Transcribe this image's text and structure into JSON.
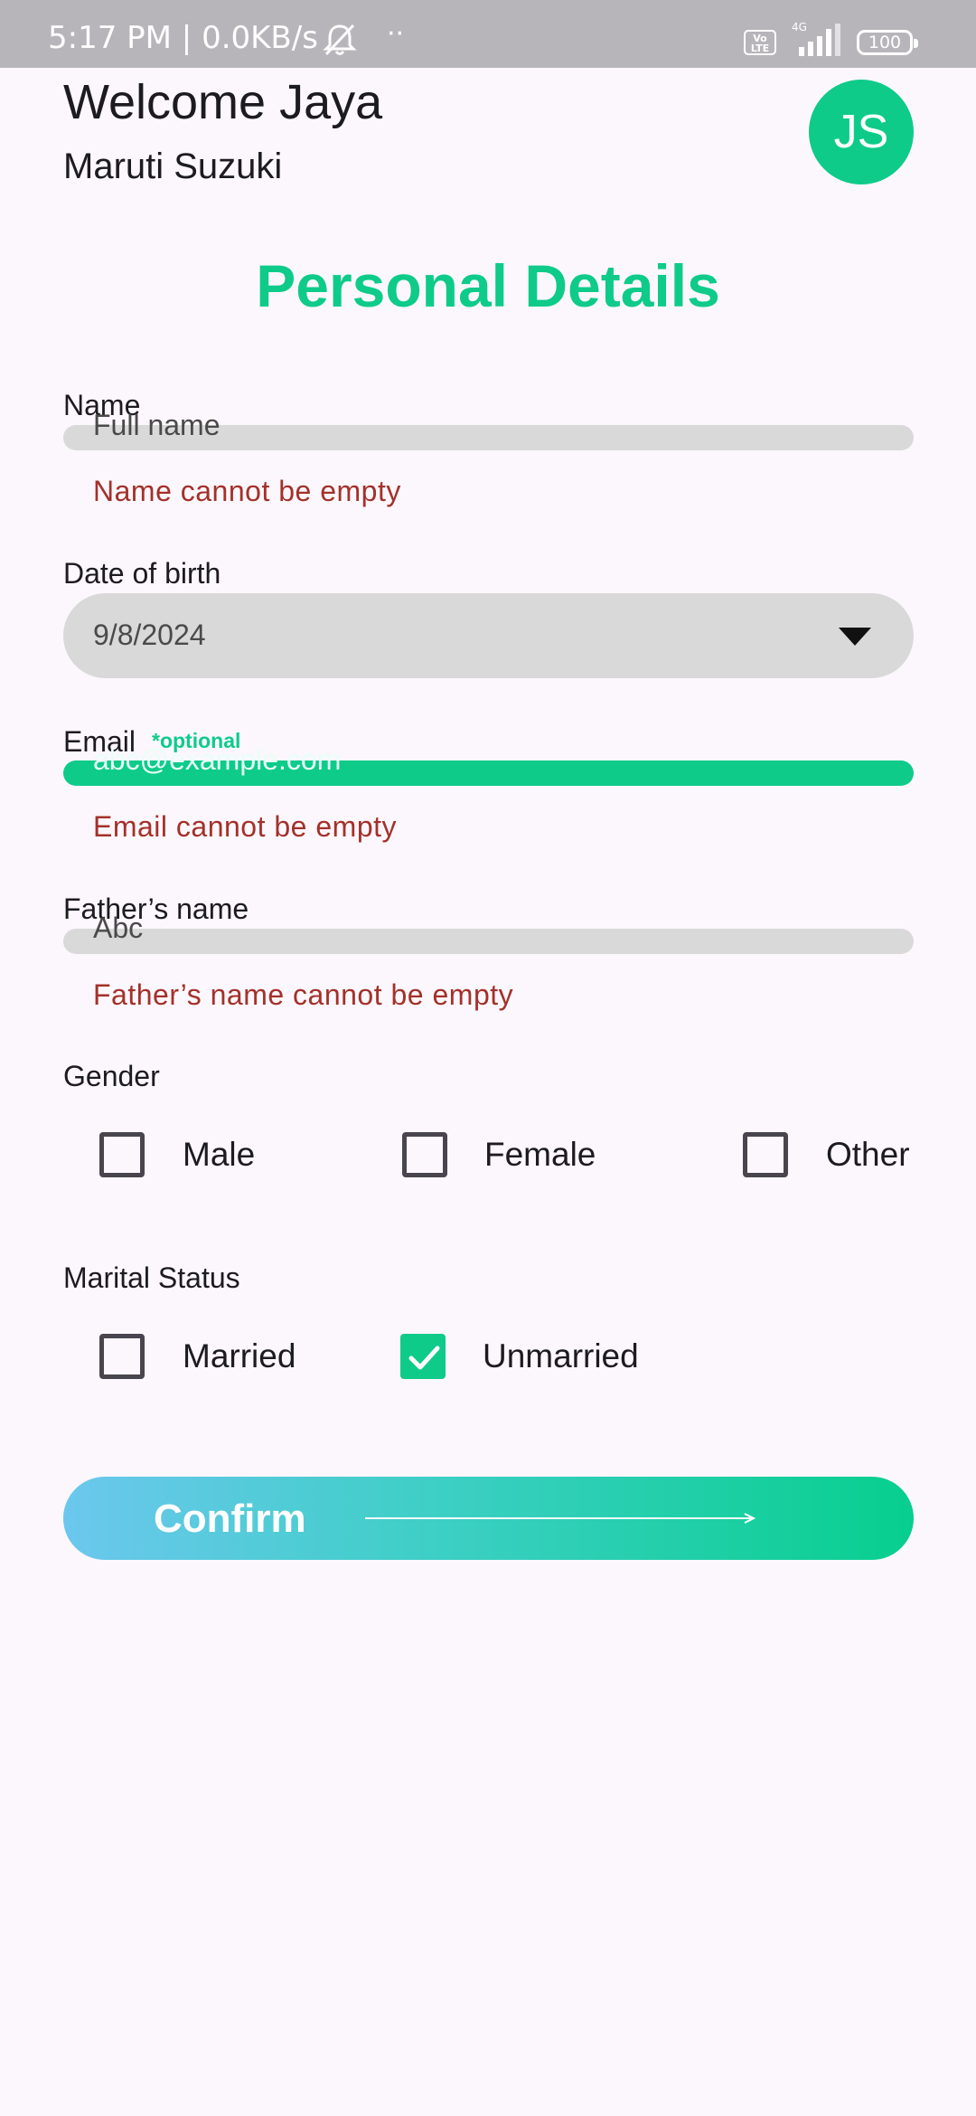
{
  "status_bar": {
    "time": "5:17 PM | 0.0KB/s",
    "dots": "··",
    "volte": "Vo LTE",
    "network": "4G",
    "battery": "100"
  },
  "header": {
    "welcome": "Welcome Jaya",
    "company": "Maruti Suzuki",
    "avatar_initials": "JS"
  },
  "form": {
    "title": "Personal Details",
    "name": {
      "label": "Name",
      "placeholder": "Full name",
      "error": "Name cannot be empty"
    },
    "dob": {
      "label": "Date of birth",
      "value": "9/8/2024"
    },
    "email": {
      "label": "Email",
      "optional_tag": "*optional",
      "placeholder": "abc@example.com",
      "error": "Email cannot be empty"
    },
    "father": {
      "label": "Father’s name",
      "placeholder": "Abc",
      "error": "Father’s name cannot be empty"
    },
    "gender": {
      "label": "Gender",
      "options": [
        {
          "label": "Male",
          "checked": false
        },
        {
          "label": "Female",
          "checked": false
        },
        {
          "label": "Other",
          "checked": false
        }
      ]
    },
    "marital": {
      "label": "Marital Status",
      "options": [
        {
          "label": "Married",
          "checked": false
        },
        {
          "label": "Unmarried",
          "checked": true
        }
      ]
    },
    "confirm_label": "Confirm"
  },
  "colors": {
    "accent": "#0ecb8a",
    "error": "#a3312a",
    "field_bg": "#d9d9d9",
    "background": "#fcf7fc"
  }
}
